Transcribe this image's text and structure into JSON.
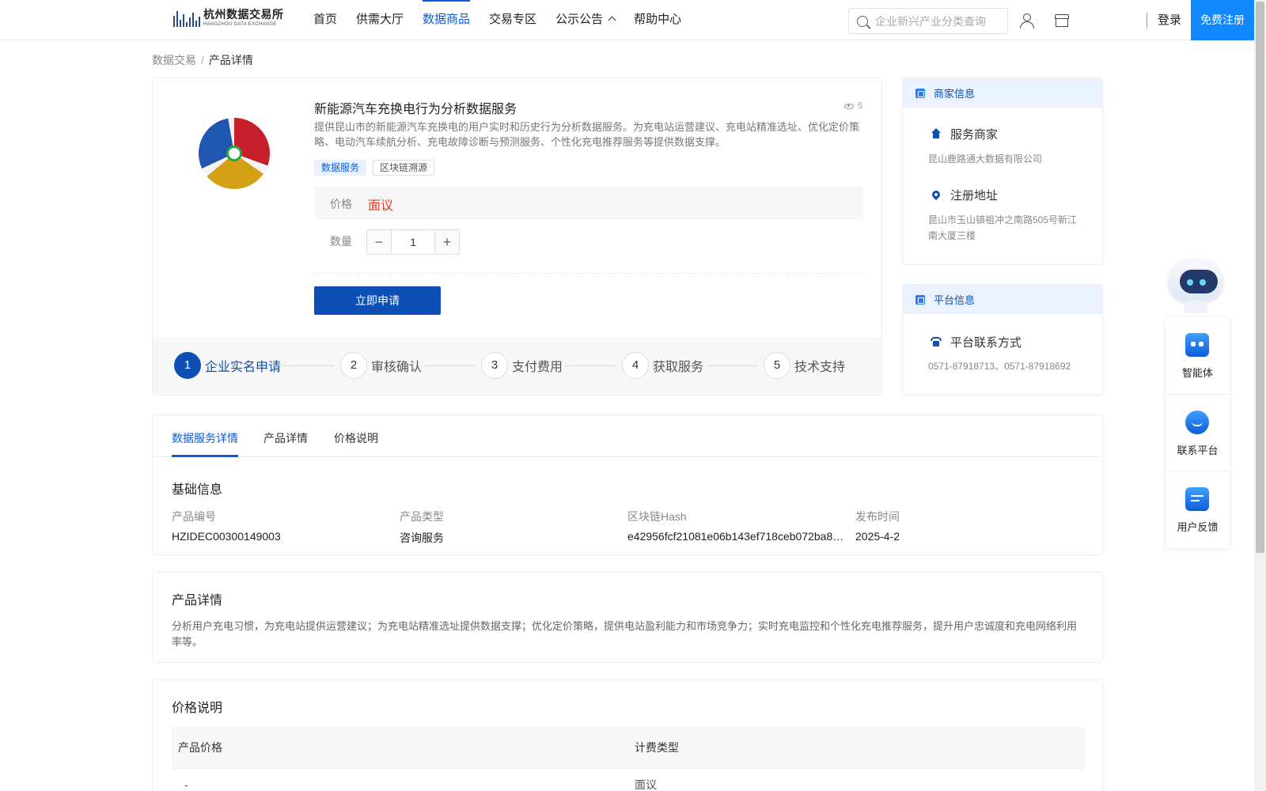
{
  "header": {
    "logo_cn": "杭州数据交易所",
    "logo_en": "HANGZHOU DATA EXCHANGE",
    "nav": [
      {
        "label": "首页"
      },
      {
        "label": "供需大厅"
      },
      {
        "label": "数据商品",
        "active": true
      },
      {
        "label": "交易专区"
      },
      {
        "label": "公示公告"
      },
      {
        "label": "帮助中心"
      }
    ],
    "search_placeholder": "企业新兴产业分类查询",
    "login": "登录",
    "register": "免费注册",
    "icons": [
      "search-icon",
      "user-icon",
      "store-icon"
    ],
    "accent_color": "#0d5bd7",
    "register_color": "#1089ff"
  },
  "breadcrumb": {
    "root": "数据交易",
    "sep": "/",
    "current": "产品详情"
  },
  "product": {
    "title": "新能源汽车充换电行为分析数据服务",
    "views": "5",
    "description": "提供昆山市的新能源汽车充换电的用户实时和历史行为分析数据服务。为充电站运营建议、充电站精准选址、优化定价策略、电动汽车续航分析、充电故障诊断与预测服务、个性化充电推荐服务等提供数据支撑。",
    "tags": [
      "数据服务",
      "区块链溯源"
    ],
    "price_label": "价格",
    "price_value": "面议",
    "price_color": "#e23c2a",
    "qty_label": "数量",
    "qty_value": "1",
    "apply_button": "立即申请",
    "steps": [
      {
        "num": "1",
        "label": "企业实名申请",
        "active": true
      },
      {
        "num": "2",
        "label": "审核确认"
      },
      {
        "num": "3",
        "label": "支付费用"
      },
      {
        "num": "4",
        "label": "获取服务"
      },
      {
        "num": "5",
        "label": "技术支持"
      }
    ]
  },
  "merchant": {
    "title": "商家信息",
    "service_label": "服务商家",
    "service_value": "昆山鹿路通大数据有限公司",
    "address_label": "注册地址",
    "address_value": "昆山市玉山镇祖冲之南路505号新江南大厦三楼"
  },
  "platform": {
    "title": "平台信息",
    "contact_label": "平台联系方式",
    "contact_value": "0571-87918713、0571-87918692"
  },
  "float_panel": {
    "items": [
      {
        "label": "智能体",
        "icon": "robot-chat-icon"
      },
      {
        "label": "联系平台",
        "icon": "headset-icon"
      },
      {
        "label": "用户反馈",
        "icon": "feedback-icon"
      }
    ]
  },
  "tabs": [
    {
      "label": "数据服务详情",
      "active": true
    },
    {
      "label": "产品详情"
    },
    {
      "label": "价格说明"
    }
  ],
  "basic_info": {
    "title": "基础信息",
    "fields": [
      {
        "label": "产品编号",
        "value": "HZIDEC00300149003"
      },
      {
        "label": "产品类型",
        "value": "咨询服务"
      },
      {
        "label": "区块链Hash",
        "value": "e42956fcf21081e06b143ef718ceb072ba8…"
      },
      {
        "label": "发布时间",
        "value": "2025-4-2"
      }
    ]
  },
  "product_detail": {
    "title": "产品详情",
    "text": "分析用户充电习惯，为充电站提供运营建议；为充电站精准选址提供数据支撑；优化定价策略，提供电站盈利能力和市场竞争力；实时充电监控和个性化充电推荐服务，提升用户忠诚度和充电网络利用率等。"
  },
  "price_explain": {
    "title": "价格说明",
    "headers": [
      "产品价格",
      "计费类型"
    ],
    "row": [
      "-",
      "面议"
    ]
  }
}
